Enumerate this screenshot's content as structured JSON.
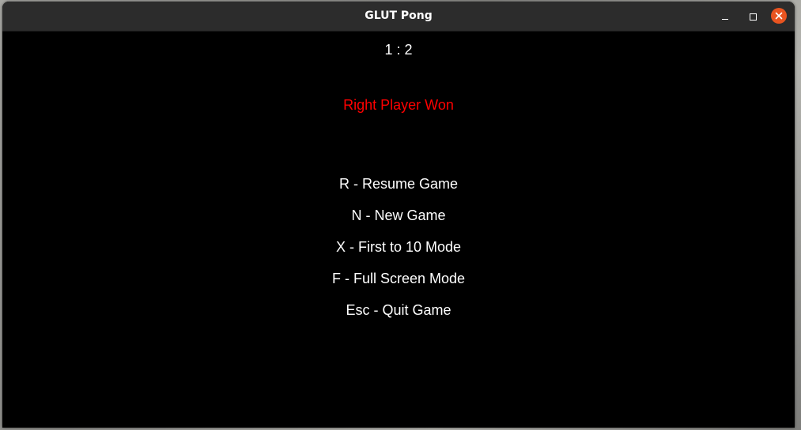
{
  "window": {
    "title": "GLUT Pong",
    "close_button_color": "#e95420"
  },
  "game": {
    "score": "1 : 2",
    "status": "Right Player Won",
    "status_color": "#ff0000",
    "menu": [
      "R - Resume Game",
      "N - New Game",
      "X - First to 10 Mode",
      "F - Full Screen Mode",
      "Esc - Quit Game"
    ]
  },
  "icons": {
    "minimize": "minimize-icon",
    "maximize": "maximize-icon",
    "close": "close-icon"
  }
}
